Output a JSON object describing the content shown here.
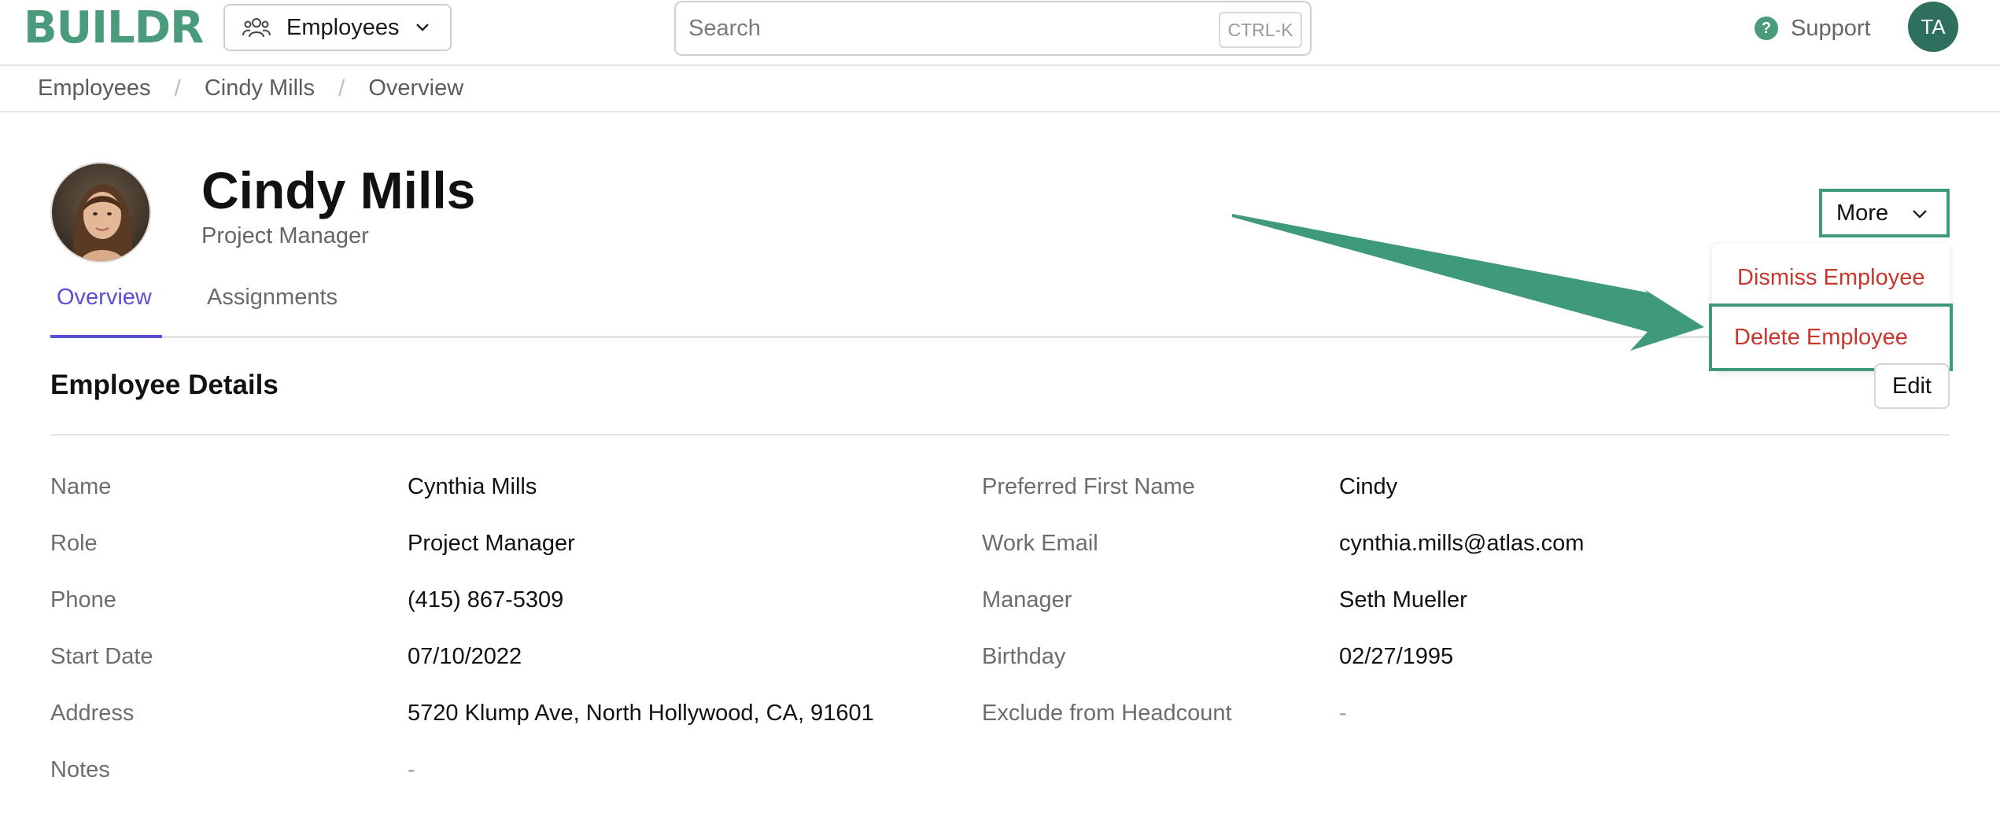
{
  "app": {
    "logo": "BUILDR",
    "module_selector": {
      "label": "Employees",
      "icon": "people-icon"
    },
    "search": {
      "placeholder": "Search",
      "shortcut": "CTRL-K"
    },
    "support": {
      "label": "Support",
      "icon": "help-circle-icon"
    },
    "user_avatar": {
      "initials": "TA"
    },
    "brand_color": "#4a9a7c"
  },
  "breadcrumb": [
    "Employees",
    "Cindy Mills",
    "Overview"
  ],
  "profile": {
    "name": "Cindy Mills",
    "title": "Project Manager"
  },
  "tabs": [
    {
      "label": "Overview",
      "active": true
    },
    {
      "label": "Assignments",
      "active": false
    }
  ],
  "actions": {
    "more_label": "More",
    "menu_items": [
      {
        "label": "Dismiss Employee",
        "color": "#c8372d"
      },
      {
        "label": "Delete Employee",
        "color": "#c8372d",
        "highlighted": true
      }
    ]
  },
  "details": {
    "section_title": "Employee Details",
    "edit_label": "Edit",
    "left": [
      {
        "label": "Name",
        "value": "Cynthia Mills"
      },
      {
        "label": "Role",
        "value": "Project Manager"
      },
      {
        "label": "Phone",
        "value": "(415) 867-5309"
      },
      {
        "label": "Start Date",
        "value": "07/10/2022"
      },
      {
        "label": "Address",
        "value": "5720 Klump Ave, North Hollywood, CA, 91601"
      },
      {
        "label": "Notes",
        "value": "-"
      }
    ],
    "right": [
      {
        "label": "Preferred First Name",
        "value": "Cindy"
      },
      {
        "label": "Work Email",
        "value": "cynthia.mills@atlas.com"
      },
      {
        "label": "Manager",
        "value": "Seth Mueller"
      },
      {
        "label": "Birthday",
        "value": "02/27/1995"
      },
      {
        "label": "Exclude from Headcount",
        "value": "-"
      }
    ]
  },
  "annotation_color": "#3e9a78"
}
